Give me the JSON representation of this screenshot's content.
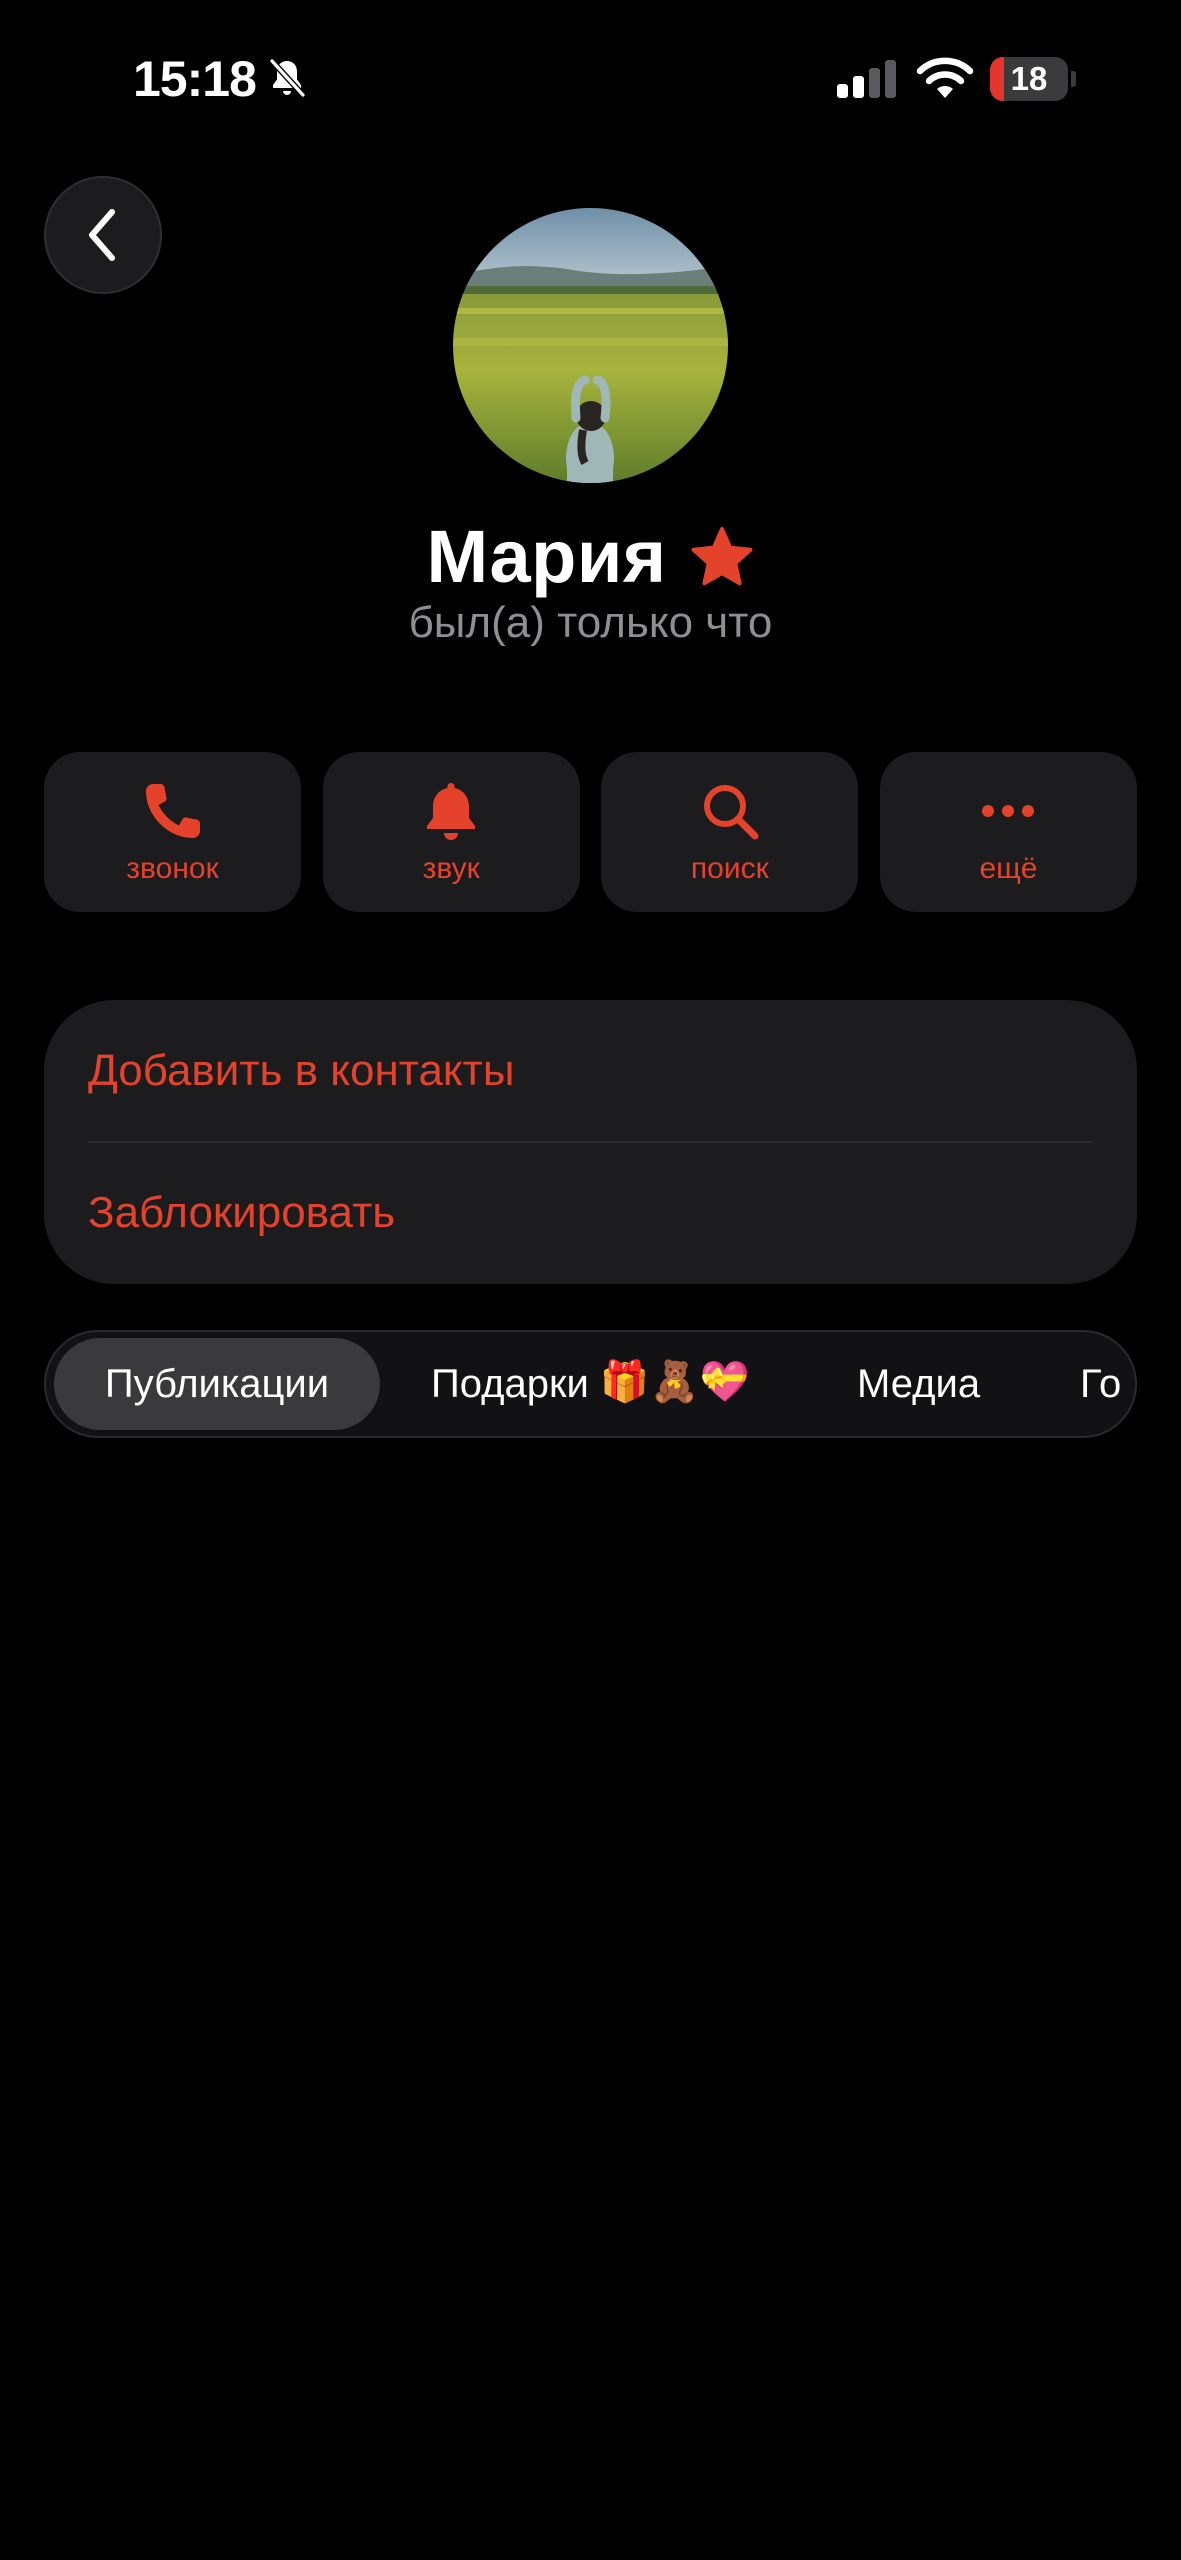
{
  "status_bar": {
    "time": "15:18",
    "battery_level": "18",
    "battery_fraction": 0.18,
    "icons": [
      "bell-slash-icon",
      "signal-icon",
      "wifi-icon",
      "battery-icon"
    ]
  },
  "header": {
    "back_icon": "chevron-left-icon"
  },
  "profile": {
    "name": "Мария",
    "badge_icon": "star-icon",
    "status": "был(а) только что"
  },
  "actions": [
    {
      "label": "звонок",
      "icon": "phone-icon"
    },
    {
      "label": "звук",
      "icon": "bell-icon"
    },
    {
      "label": "поиск",
      "icon": "search-icon"
    },
    {
      "label": "ещё",
      "icon": "more-icon"
    }
  ],
  "menu": {
    "add_contact": "Добавить в контакты",
    "block": "Заблокировать"
  },
  "tabs": [
    {
      "label": "Публикации",
      "active": true
    },
    {
      "label": "Подарки",
      "emojis": "🎁🧸💝",
      "active": false
    },
    {
      "label": "Медиа",
      "active": false
    },
    {
      "label": "Го...",
      "active": false
    }
  ],
  "tab_labels": {
    "publications": "Публикации",
    "gifts": "Подарки",
    "gifts_emoji": "🎁🧸💝",
    "media": "Медиа",
    "more": "Го"
  },
  "colors": {
    "accent": "#e5422c",
    "background": "#000000",
    "card": "#1c1c1e",
    "secondary_text": "#8e8e93"
  }
}
